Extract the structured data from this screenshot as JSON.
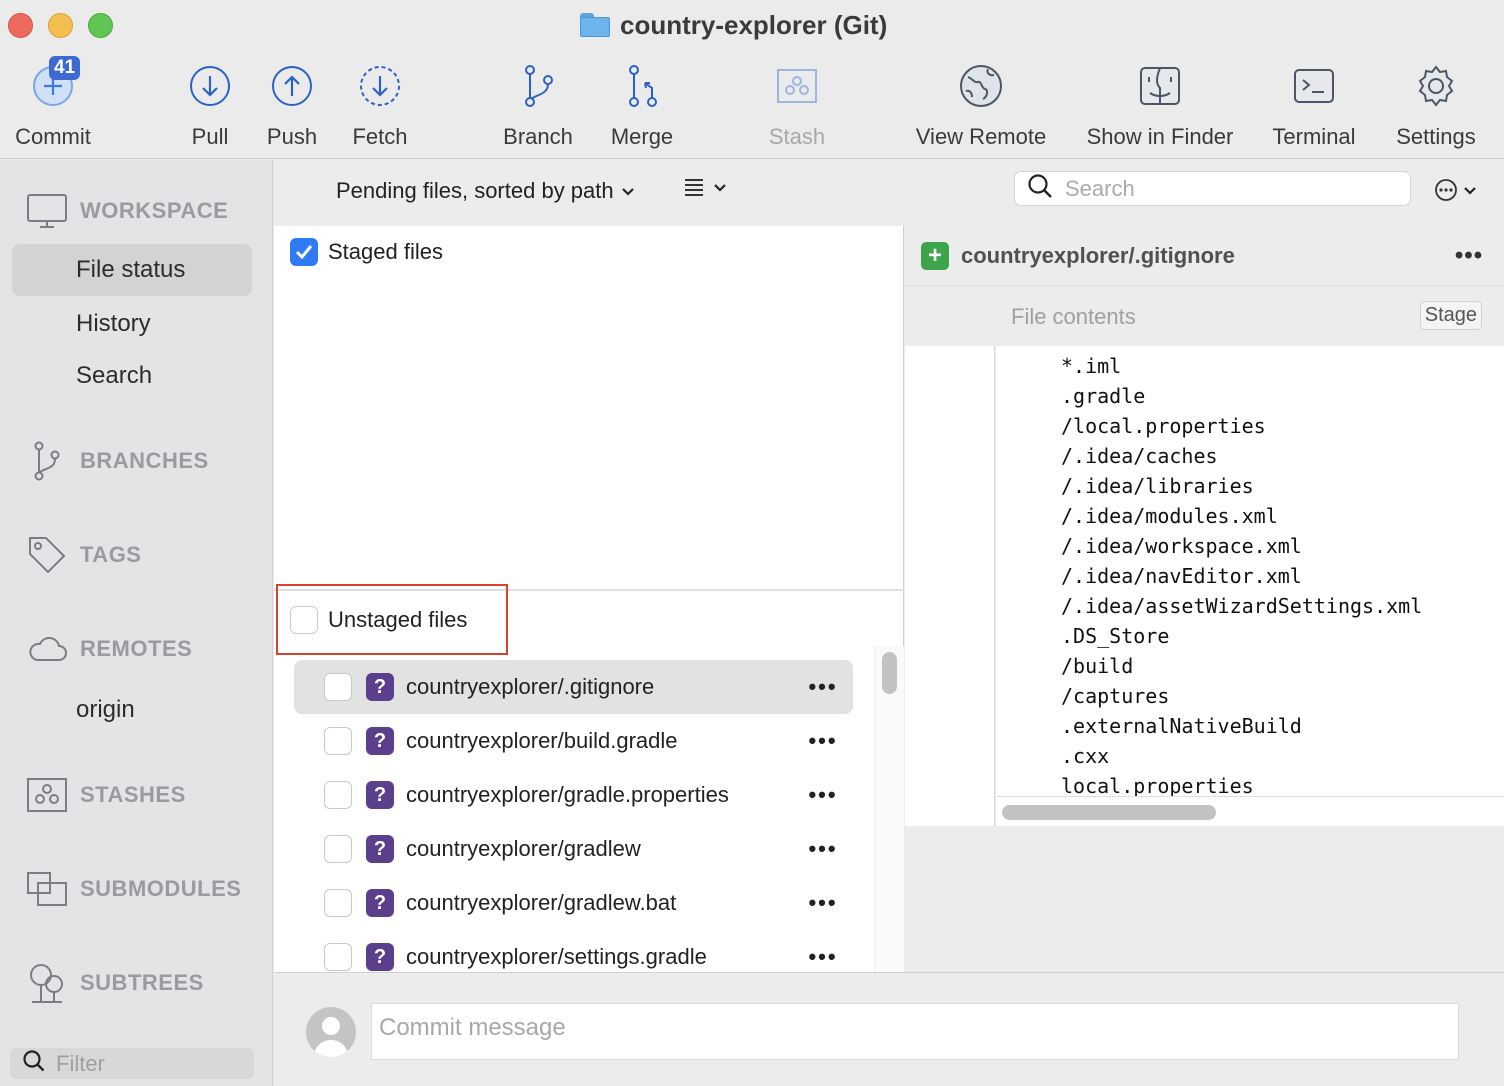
{
  "window": {
    "title": "country-explorer (Git)"
  },
  "toolbar": {
    "commit": {
      "label": "Commit",
      "badge": "41"
    },
    "pull": "Pull",
    "push": "Push",
    "fetch": "Fetch",
    "branch": "Branch",
    "merge": "Merge",
    "stash": "Stash",
    "view_remote": "View Remote",
    "show_in_finder": "Show in Finder",
    "terminal": "Terminal",
    "settings": "Settings"
  },
  "sidebar": {
    "workspace": "WORKSPACE",
    "workspace_items": [
      "File status",
      "History",
      "Search"
    ],
    "branches": "BRANCHES",
    "tags": "TAGS",
    "remotes": "REMOTES",
    "remote_items": [
      "origin"
    ],
    "stashes": "STASHES",
    "submodules": "SUBMODULES",
    "subtrees": "SUBTREES",
    "filter_placeholder": "Filter"
  },
  "filterbar": {
    "sort_label": "Pending files, sorted by path",
    "search_placeholder": "Search"
  },
  "staged": {
    "label": "Staged files",
    "checked": true
  },
  "unstaged": {
    "label": "Unstaged files",
    "checked": false,
    "files": [
      {
        "name": "countryexplorer/.gitignore",
        "status": "?",
        "selected": true
      },
      {
        "name": "countryexplorer/build.gradle",
        "status": "?"
      },
      {
        "name": "countryexplorer/gradle.properties",
        "status": "?"
      },
      {
        "name": "countryexplorer/gradlew",
        "status": "?"
      },
      {
        "name": "countryexplorer/gradlew.bat",
        "status": "?"
      },
      {
        "name": "countryexplorer/settings.gradle",
        "status": "?"
      }
    ],
    "more_label": "•••"
  },
  "diff": {
    "file": "countryexplorer/.gitignore",
    "more_label": "•••",
    "contents_label": "File contents",
    "stage_label": "Stage",
    "lines": [
      "*.iml",
      ".gradle",
      "/local.properties",
      "/.idea/caches",
      "/.idea/libraries",
      "/.idea/modules.xml",
      "/.idea/workspace.xml",
      "/.idea/navEditor.xml",
      "/.idea/assetWizardSettings.xml",
      ".DS_Store",
      "/build",
      "/captures",
      ".externalNativeBuild",
      ".cxx",
      "local.properties"
    ]
  },
  "commit": {
    "placeholder": "Commit message"
  },
  "colors": {
    "accent": "#2f7af5",
    "badge": "#3d6ad0",
    "untracked": "#5b3e8c",
    "added": "#3ea44b",
    "highlight_border": "#d9412f"
  },
  "icons": [
    "plus-circle-icon",
    "arrow-down-circle-icon",
    "arrow-up-circle-icon",
    "fetch-dashed-circle-icon",
    "branch-icon",
    "merge-icon",
    "stash-icon",
    "globe-icon",
    "finder-icon",
    "terminal-icon",
    "gear-icon",
    "monitor-icon",
    "tag-icon",
    "cloud-icon",
    "submodule-icon",
    "tree-icon",
    "search-icon",
    "ellipsis-circle-icon",
    "list-icon",
    "chevron-down-icon",
    "question-icon",
    "plus-icon",
    "avatar-icon"
  ]
}
